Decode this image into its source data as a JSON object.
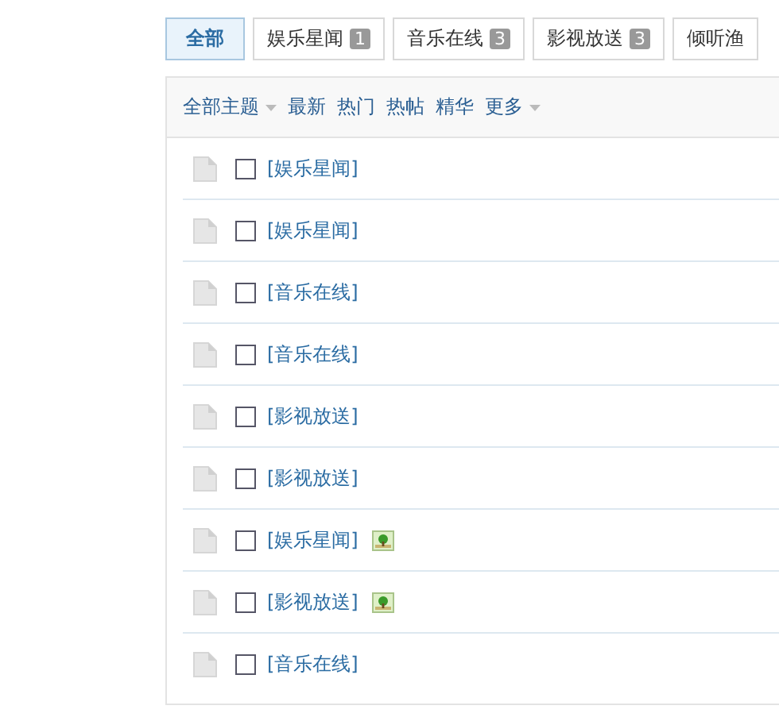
{
  "tabs": [
    {
      "label": "全部",
      "selected": true
    },
    {
      "label": "娱乐星闻",
      "count": "1",
      "selected": false
    },
    {
      "label": "音乐在线",
      "count": "3",
      "selected": false
    },
    {
      "label": "影视放送",
      "count": "3",
      "selected": false
    },
    {
      "label": "倾听渔",
      "selected": false
    }
  ],
  "filters": [
    {
      "label": "全部主题",
      "dropdown": true
    },
    {
      "label": "最新",
      "dropdown": false
    },
    {
      "label": "热门",
      "dropdown": false
    },
    {
      "label": "热帖",
      "dropdown": false
    },
    {
      "label": "精华",
      "dropdown": false
    },
    {
      "label": "更多",
      "dropdown": true
    }
  ],
  "threads": [
    {
      "category": "[娱乐星闻]",
      "checked": false
    },
    {
      "category": "[娱乐星闻]",
      "checked": false
    },
    {
      "category": "[音乐在线]",
      "checked": false
    },
    {
      "category": "[音乐在线]",
      "checked": false
    },
    {
      "category": "[影视放送]",
      "checked": false
    },
    {
      "category": "[影视放送]",
      "checked": false
    },
    {
      "category": "[娱乐星闻]",
      "checked": false,
      "has_image": true
    },
    {
      "category": "[影视放送]",
      "checked": false,
      "has_image": true
    },
    {
      "category": "[音乐在线]",
      "checked": false
    }
  ]
}
